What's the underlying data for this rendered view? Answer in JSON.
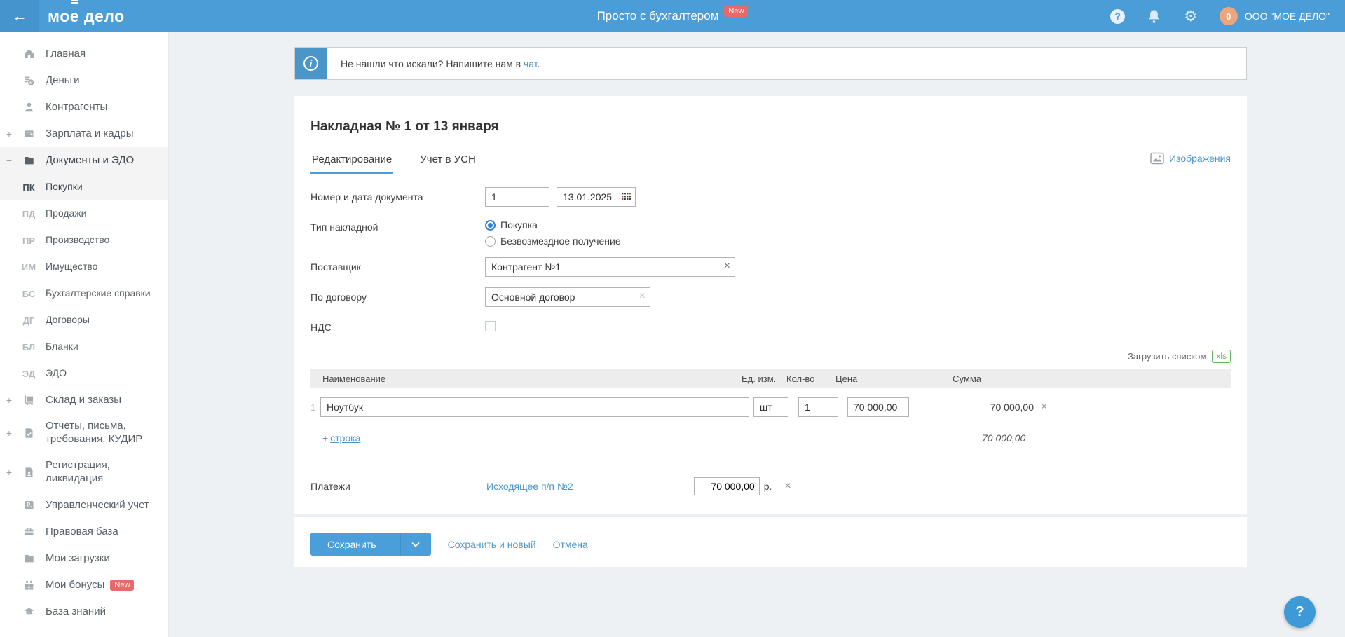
{
  "header": {
    "logo": "моё дело",
    "tagline": "Просто с бухгалтером",
    "tagline_badge": "New",
    "avatar_letter": "0",
    "company": "ООО \"МОЕ ДЕЛО\"",
    "help_glyph": "?",
    "gear_glyph": "⚙",
    "back_glyph": "←"
  },
  "banner": {
    "text_before": "Не нашли что искали? Напишите нам в ",
    "link": "чат",
    "text_after": ".",
    "info_glyph": "i"
  },
  "sidebar": {
    "items": [
      {
        "label": "Главная"
      },
      {
        "label": "Деньги"
      },
      {
        "label": "Контрагенты"
      },
      {
        "expander": "+",
        "label": "Зарплата и кадры"
      },
      {
        "expander": "−",
        "label": "Документы и ЭДО"
      },
      {
        "code": "ПК",
        "label": "Покупки"
      },
      {
        "code": "ПД",
        "label": "Продажи"
      },
      {
        "code": "ПР",
        "label": "Производство"
      },
      {
        "code": "ИМ",
        "label": "Имущество"
      },
      {
        "code": "БС",
        "label": "Бухгалтерские справки"
      },
      {
        "code": "ДГ",
        "label": "Договоры"
      },
      {
        "code": "БЛ",
        "label": "Бланки"
      },
      {
        "code": "ЭД",
        "label": "ЭДО"
      },
      {
        "expander": "+",
        "label": "Склад и заказы"
      },
      {
        "expander": "+",
        "label": "Отчеты, письма, требования, КУДИР"
      },
      {
        "expander": "+",
        "label": "Регистрация, ликвидация"
      },
      {
        "label": "Управленческий учет"
      },
      {
        "label": "Правовая база"
      },
      {
        "label": "Мои загрузки"
      },
      {
        "label": "Мои бонусы",
        "badge": "New"
      },
      {
        "label": "База знаний"
      }
    ]
  },
  "page": {
    "title": "Накладная № 1 от 13 января",
    "tabs": [
      {
        "label": "Редактирование"
      },
      {
        "label": "Учет в УСН"
      }
    ],
    "images_link": "Изображения"
  },
  "form": {
    "number_date_label": "Номер и дата документа",
    "number_value": "1",
    "date_value": "13.01.2025",
    "type_label": "Тип накладной",
    "type_option_1": "Покупка",
    "type_option_2": "Безвозмездное получение",
    "supplier_label": "Поставщик",
    "supplier_value": "Контрагент №1",
    "contract_label": "По договору",
    "contract_value": "Основной договор",
    "vat_label": "НДС",
    "clear_glyph": "×"
  },
  "items_table": {
    "upload_label": "Загрузить списком",
    "xls_badge": "xls",
    "columns": {
      "name": "Наименование",
      "unit": "Ед. изм.",
      "qty": "Кол-во",
      "price": "Цена",
      "sum": "Сумма"
    },
    "rows": [
      {
        "num": "1",
        "name": "Ноутбук",
        "unit": "шт",
        "qty": "1",
        "price": "70 000,00",
        "sum": "70 000,00",
        "delete_glyph": "×"
      }
    ],
    "add_row_plus": "+",
    "add_row_label": "строка",
    "total": "70 000,00"
  },
  "payments": {
    "label": "Платежи",
    "link": "Исходящее п/п №2",
    "amount": "70 000,00",
    "currency": "р.",
    "remove_glyph": "×"
  },
  "footer": {
    "save": "Сохранить",
    "save_and_new": "Сохранить и новый",
    "cancel": "Отмена"
  },
  "fab": {
    "label": "?"
  },
  "colors": {
    "header_blue": "#4a9dd6",
    "accent_blue": "#4a9ed9",
    "link_blue": "#4a96c8",
    "badge_red": "#e9696a",
    "xls_green": "#62b562",
    "avatar_orange": "#eda57d"
  }
}
